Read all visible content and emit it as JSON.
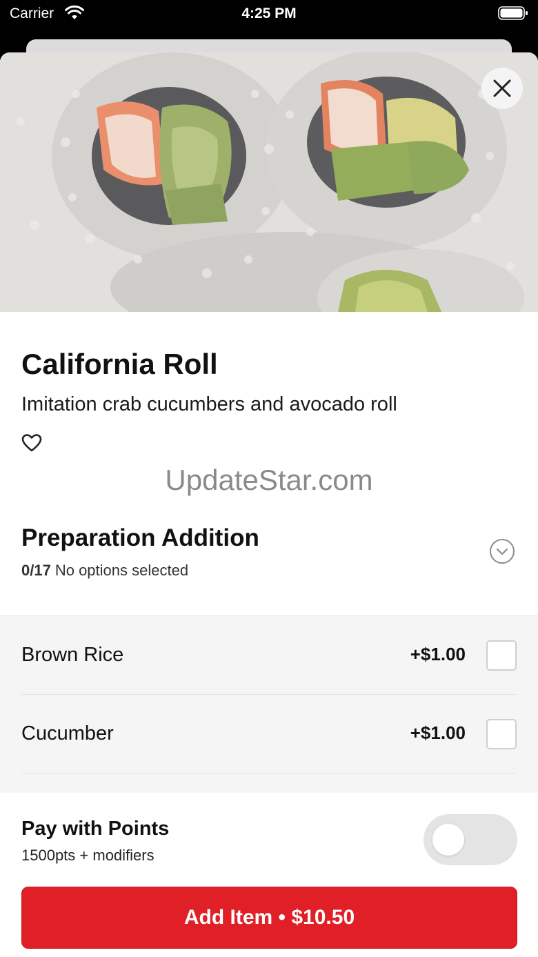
{
  "status_bar": {
    "carrier": "Carrier",
    "time": "4:25 PM"
  },
  "item": {
    "title": "California Roll",
    "description": "Imitation crab cucumbers and avocado roll",
    "image_alt": "california-roll-photo"
  },
  "watermark": "UpdateStar.com",
  "section": {
    "title": "Preparation Addition",
    "count": "0/17",
    "status": "No options selected"
  },
  "options": [
    {
      "name": "Brown Rice",
      "price": "+$1.00",
      "checked": false
    },
    {
      "name": "Cucumber",
      "price": "+$1.00",
      "checked": false
    }
  ],
  "footer": {
    "points_title": "Pay with Points",
    "points_subtitle": "1500pts + modifiers",
    "points_enabled": false,
    "add_button_label": "Add Item • $10.50"
  },
  "colors": {
    "accent": "#e01f26",
    "toggle_off": "#e4e4e4",
    "options_bg": "#f5f5f5"
  },
  "icons": {
    "wifi": "wifi-icon",
    "battery": "battery-icon",
    "close": "close-icon",
    "favorite": "heart-outline-icon",
    "expand": "chevron-down-circle-icon"
  }
}
